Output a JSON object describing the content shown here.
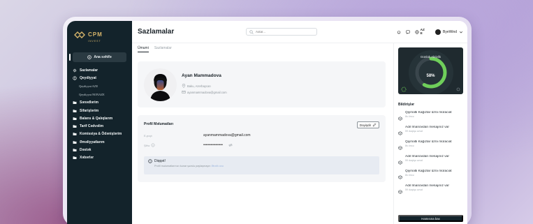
{
  "logo": {
    "title": "CPM",
    "subtitle": "INVEST"
  },
  "sidebar": {
    "home_label": "Ana səhifə",
    "items": [
      {
        "label": "Sazlamalar",
        "icon": "gear-icon"
      },
      {
        "label": "Qeydiyyat",
        "icon": "user-add-icon"
      },
      {
        "label": "Qeydiyyat AZE",
        "sub": true
      },
      {
        "label": "Qeydiyyat NONAZE",
        "sub": true
      },
      {
        "label": "Sənədlərim",
        "icon": "folder-icon"
      },
      {
        "label": "Sifarişlərim",
        "icon": "folder-icon"
      },
      {
        "label": "Balans & Qalıqlarım",
        "icon": "folder-icon"
      },
      {
        "label": "Tarif Cədvəlim",
        "icon": "folder-icon"
      },
      {
        "label": "Komissiya & Ödənişlərim",
        "icon": "folder-icon"
      },
      {
        "label": "Əməliyyatlarım",
        "icon": "folder-icon"
      },
      {
        "label": "Dəstək",
        "icon": "folder-icon"
      },
      {
        "label": "Xəbərlər",
        "icon": "folder-icon"
      }
    ]
  },
  "header": {
    "title": "Sazlamalar",
    "search_placeholder": "Axtar...",
    "lang_top": "AZ",
    "lang_bottom": "E",
    "user_name": "ByeWind"
  },
  "tabs": [
    {
      "label": "Ümumi",
      "active": true
    },
    {
      "label": "Sazlamalar",
      "active": false
    }
  ],
  "profile": {
    "name": "Ayan Mammadova",
    "location": "Baku, Azerbaycan",
    "email": "ayanmammadova@gmail.com"
  },
  "info": {
    "title": "Profil Məlumatları",
    "edit_label": "Dəyişdir",
    "email_label": "E-poçt",
    "email_value": "ayanmammadova@gmail.com",
    "password_label": "Şifrə",
    "password_value": "••••••••••••••••"
  },
  "note": {
    "title": "Diqqət!",
    "text": "Profil məlumatlarınızı kənar şəxslə paylaşmayın",
    "link": "Ətraflı oxu"
  },
  "activity": {
    "title": "Günlük Aktivlik",
    "percent": 58,
    "percent_label": "58%"
  },
  "notifications": {
    "title": "Bildirişlər",
    "items": [
      {
        "text": "Qiymətli Kağızlar üzrə müraciət",
        "time": "8s öncə"
      },
      {
        "text": "Adil İmanovdan mesajınız var",
        "time": "59 dəqiqə əvvəl"
      },
      {
        "text": "Qiymətli Kağızlar üzrə müraciət",
        "time": "8s öncə"
      },
      {
        "text": "Adil İmanovdan mesajınız var",
        "time": "59 dəqiqə əvvəl"
      },
      {
        "text": "Qiymətli Kağızlar üzrə müraciət",
        "time": "8s öncə"
      },
      {
        "text": "Adil İmanovdan mesajınız var",
        "time": "59 dəqiqə əvvəl"
      }
    ],
    "all_label": "Hamısına bax"
  },
  "colors": {
    "sidebar": "#13232b",
    "accent_gold": "#d6b46a",
    "activity_green": "#6fcf5a"
  }
}
